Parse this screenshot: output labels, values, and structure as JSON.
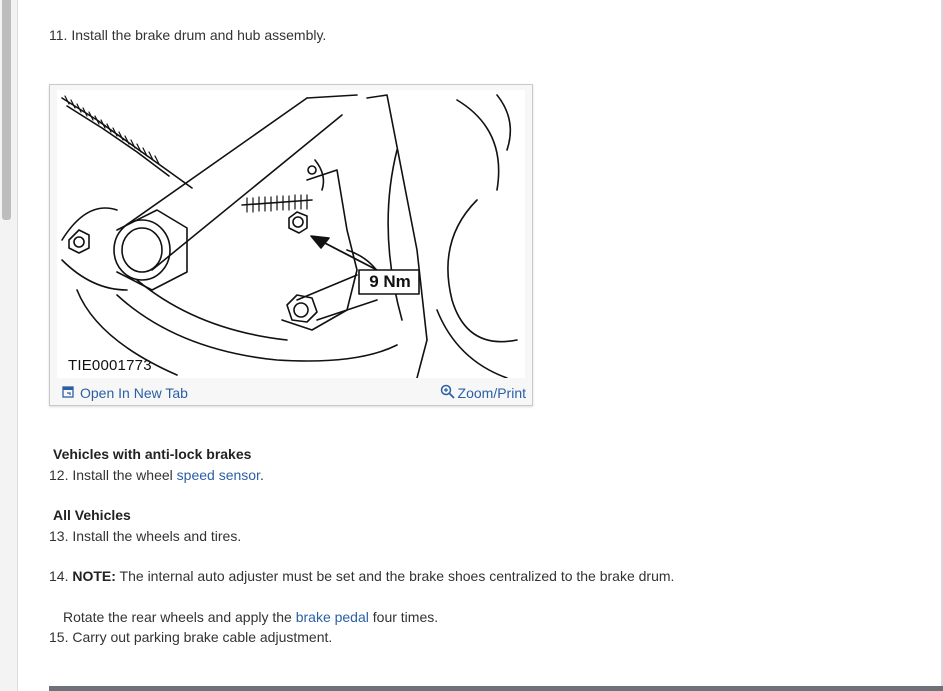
{
  "steps": {
    "s11": {
      "num": "11.",
      "text": "Install the brake drum and hub assembly."
    },
    "figure": {
      "callout": "9 Nm",
      "caption": "TIE0001773",
      "open_tab_label": "Open In New Tab",
      "zoom_label": "Zoom/Print"
    },
    "abs_heading": "Vehicles with anti-lock brakes",
    "s12": {
      "num": "12.",
      "before": "Install the wheel ",
      "link": "speed sensor",
      "after": "."
    },
    "all_heading": "All Vehicles",
    "s13": {
      "num": "13.",
      "text": "Install the wheels and tires."
    },
    "s14": {
      "num": "14.",
      "note_label": "NOTE:",
      "note_text": " The internal auto adjuster must be set and the brake shoes centralized to the brake drum."
    },
    "s14b": {
      "before": "Rotate the rear wheels and apply the ",
      "link": "brake pedal",
      "after": " four times."
    },
    "s15": {
      "num": "15.",
      "text": "Carry out parking brake cable adjustment."
    }
  }
}
